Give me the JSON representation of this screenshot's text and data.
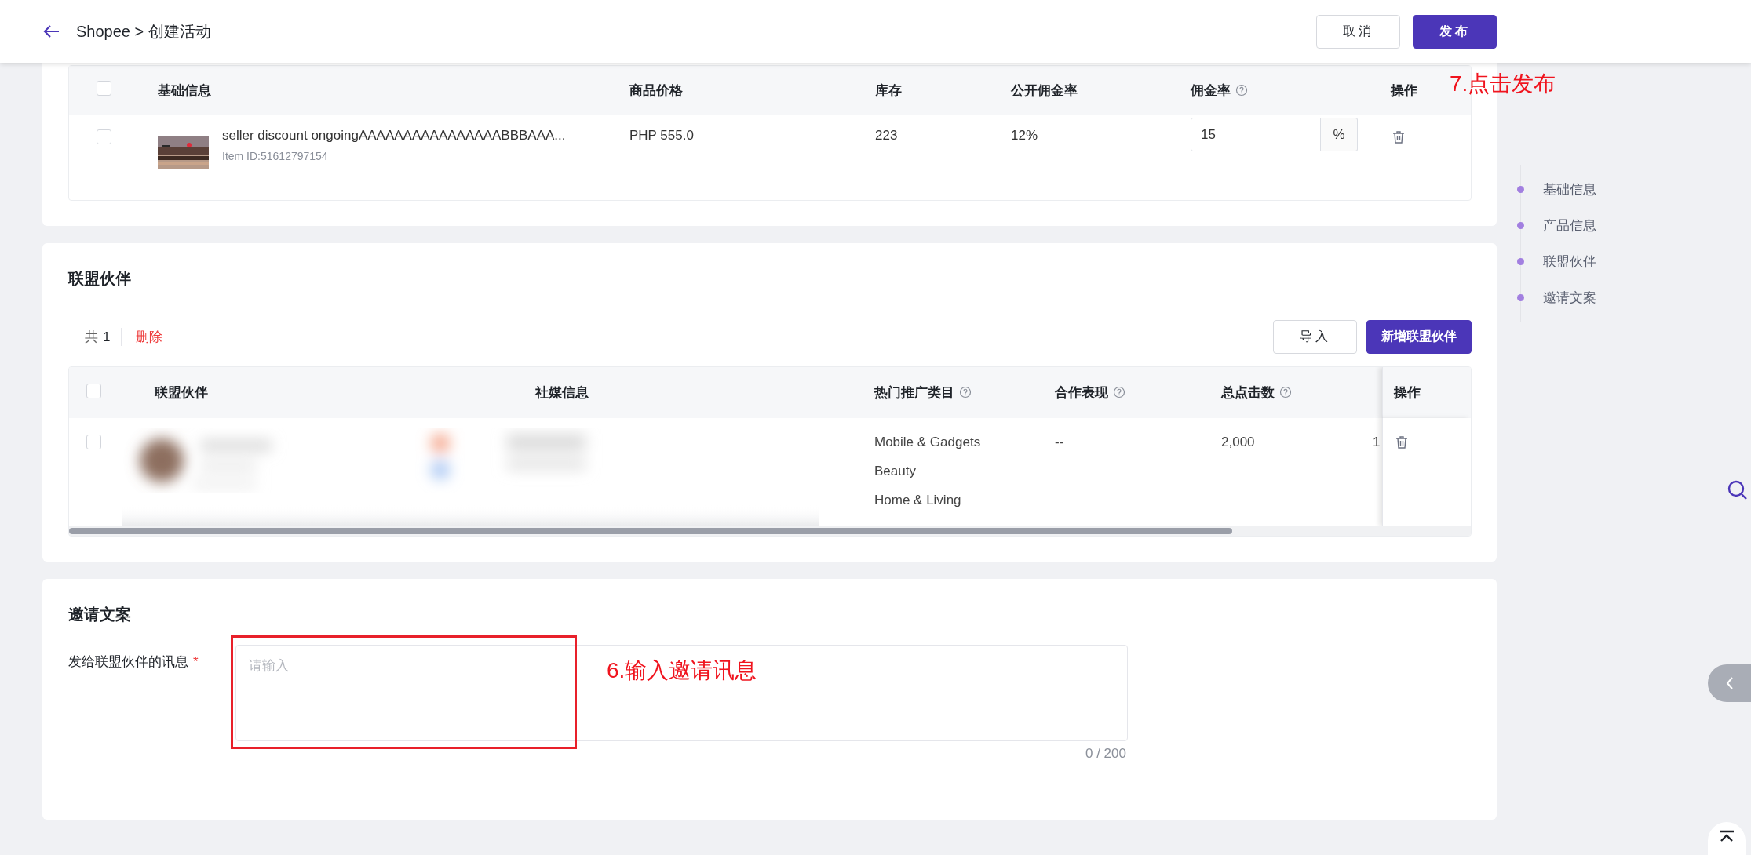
{
  "header": {
    "title": "Shopee > 创建活动",
    "buttons": [
      {
        "label": "取消",
        "kind": "secondary"
      },
      {
        "label": "发布",
        "kind": "primary"
      }
    ]
  },
  "product_table": {
    "header_checked": false,
    "columns": [
      {
        "label": "基础信息",
        "help": false
      },
      {
        "label": "商品价格",
        "help": false
      },
      {
        "label": "库存",
        "help": false
      },
      {
        "label": "公开佣金率",
        "help": false
      },
      {
        "label": "佣金率",
        "help": true
      },
      {
        "label": "操作",
        "help": false
      }
    ],
    "rows": [
      {
        "checked": false,
        "kind": "picture",
        "name": "seller discount ongoingAAAAAAAAAAAAAAAABBBAAA...",
        "item_id": "Item ID:51612797154",
        "price": "PHP 555.0",
        "stock": "223",
        "public_rate": "12%",
        "rate": "15",
        "rate_unit": "%"
      }
    ]
  },
  "partners": {
    "title": "联盟伙伴",
    "count_label": "共",
    "count": "1",
    "delete_label": "删除",
    "buttons": [
      {
        "label": "导入",
        "kind": "secondary"
      },
      {
        "label": "新增联盟伙伴",
        "kind": "primary"
      }
    ],
    "header_checked": false,
    "columns": [
      {
        "label": "联盟伙伴",
        "help": false
      },
      {
        "label": "社媒信息",
        "help": false
      },
      {
        "label": "热门推广类目",
        "help": true
      },
      {
        "label": "合作表现",
        "help": true
      },
      {
        "label": "总点击数",
        "help": true
      },
      {
        "label": "操作",
        "help": false
      }
    ],
    "rows": [
      {
        "checked": false,
        "categories": [
          "Mobile & Gadgets",
          "Beauty",
          "Home & Living"
        ],
        "performance": "--",
        "clicks": "2,000",
        "column_7": "1"
      }
    ]
  },
  "invite": {
    "title": "邀请文案",
    "label": "发给联盟伙伴的讯息",
    "required_mark": "*",
    "placeholder": "请输入",
    "counter": "0 / 200"
  },
  "side_nav": {
    "items": [
      {
        "label": "基础信息"
      },
      {
        "label": "产品信息"
      },
      {
        "label": "联盟伙伴"
      },
      {
        "label": "邀请文案"
      }
    ]
  },
  "annotations": [
    {
      "text": "7.点击发布"
    },
    {
      "text": "6.输入邀请讯息"
    }
  ]
}
